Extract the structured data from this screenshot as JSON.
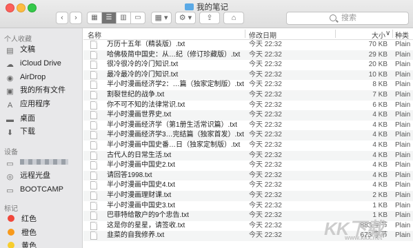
{
  "window": {
    "title": "我的笔记"
  },
  "toolbar": {
    "view_buttons": [
      "▦",
      "☰",
      "▥",
      "▭"
    ],
    "group_button": "▦ ▾",
    "action_button": "⚙ ▾",
    "share_icon": "share-icon",
    "tag_icon": "tag-icon",
    "search_placeholder": "搜索"
  },
  "sidebar": {
    "favorites_label": "个人收藏",
    "favorites": [
      {
        "label": "文稿",
        "icon": "documents-icon",
        "glyph": "▤"
      },
      {
        "label": "iCloud Drive",
        "icon": "cloud-icon",
        "glyph": "☁"
      },
      {
        "label": "AirDrop",
        "icon": "airdrop-icon",
        "glyph": "◉"
      },
      {
        "label": "我的所有文件",
        "icon": "all-files-icon",
        "glyph": "▣"
      },
      {
        "label": "应用程序",
        "icon": "applications-icon",
        "glyph": "A"
      },
      {
        "label": "桌面",
        "icon": "desktop-icon",
        "glyph": "▬"
      },
      {
        "label": "下载",
        "icon": "downloads-icon",
        "glyph": "⬇"
      }
    ],
    "devices_label": "设备",
    "devices": [
      {
        "label": "",
        "icon": "computer-icon",
        "glyph": "▭"
      },
      {
        "label": "远程光盘",
        "icon": "remote-disc-icon",
        "glyph": "◎"
      },
      {
        "label": "BOOTCAMP",
        "icon": "drive-icon",
        "glyph": "▭"
      }
    ],
    "tags_label": "标记",
    "tags": [
      {
        "label": "红色",
        "color": "#f0473b"
      },
      {
        "label": "橙色",
        "color": "#f89a1c"
      },
      {
        "label": "黄色",
        "color": "#f7cd2e"
      }
    ]
  },
  "columns": {
    "name": "名称",
    "date": "修改日期",
    "size": "大小",
    "kind": "种类",
    "sort_arrow": "∨"
  },
  "files": [
    {
      "name": "万历十五年（精装版）.txt",
      "date": "今天 22:32",
      "size": "70 KB",
      "kind": "Plain"
    },
    {
      "name": "哈佛极简中国史：从…纪（修订珍藏版）.txt",
      "date": "今天 22:32",
      "size": "29 KB",
      "kind": "Plain"
    },
    {
      "name": "很冷很冷的冷门知识.txt",
      "date": "今天 22:32",
      "size": "20 KB",
      "kind": "Plain"
    },
    {
      "name": "最冷最冷的冷门知识.txt",
      "date": "今天 22:32",
      "size": "10 KB",
      "kind": "Plain"
    },
    {
      "name": "半小时漫画经济学2：…篇（独家定制版）.txt",
      "date": "今天 22:32",
      "size": "8 KB",
      "kind": "Plain"
    },
    {
      "name": "割裂世纪的战争.txt",
      "date": "今天 22:32",
      "size": "7 KB",
      "kind": "Plain"
    },
    {
      "name": "你不可不知的法律常识.txt",
      "date": "今天 22:32",
      "size": "6 KB",
      "kind": "Plain"
    },
    {
      "name": "半小时漫画世界史.txt",
      "date": "今天 22:32",
      "size": "4 KB",
      "kind": "Plain"
    },
    {
      "name": "半小时漫画经济学（第1册生活常识篇）.txt",
      "date": "今天 22:32",
      "size": "4 KB",
      "kind": "Plain"
    },
    {
      "name": "半小时漫画经济学3…完结篇（独家首发）.txt",
      "date": "今天 22:32",
      "size": "4 KB",
      "kind": "Plain"
    },
    {
      "name": "半小时漫画中国史番…日（独家定制版）.txt",
      "date": "今天 22:32",
      "size": "4 KB",
      "kind": "Plain"
    },
    {
      "name": "古代人的日常生活.txt",
      "date": "今天 22:32",
      "size": "4 KB",
      "kind": "Plain"
    },
    {
      "name": "半小时漫画中国史2.txt",
      "date": "今天 22:32",
      "size": "4 KB",
      "kind": "Plain"
    },
    {
      "name": "请回答1998.txt",
      "date": "今天 22:32",
      "size": "4 KB",
      "kind": "Plain"
    },
    {
      "name": "半小时漫画中国史4.txt",
      "date": "今天 22:32",
      "size": "4 KB",
      "kind": "Plain"
    },
    {
      "name": "半小时漫画理财课.txt",
      "date": "今天 22:32",
      "size": "2 KB",
      "kind": "Plain"
    },
    {
      "name": "半小时漫画中国史3.txt",
      "date": "今天 22:32",
      "size": "1 KB",
      "kind": "Plain"
    },
    {
      "name": "巴菲特给散户的9个忠告.txt",
      "date": "今天 22:32",
      "size": "1 KB",
      "kind": "Plain"
    },
    {
      "name": "这是你的星星，请签收.txt",
      "date": "今天 22:32",
      "size": "883 字节",
      "kind": "Plain"
    },
    {
      "name": "韭菜的自我修养.txt",
      "date": "今天 22:32",
      "size": "673 字节",
      "kind": "Plain"
    }
  ],
  "watermark": {
    "main": "KK下载",
    "sub": "www.kkx.net"
  }
}
